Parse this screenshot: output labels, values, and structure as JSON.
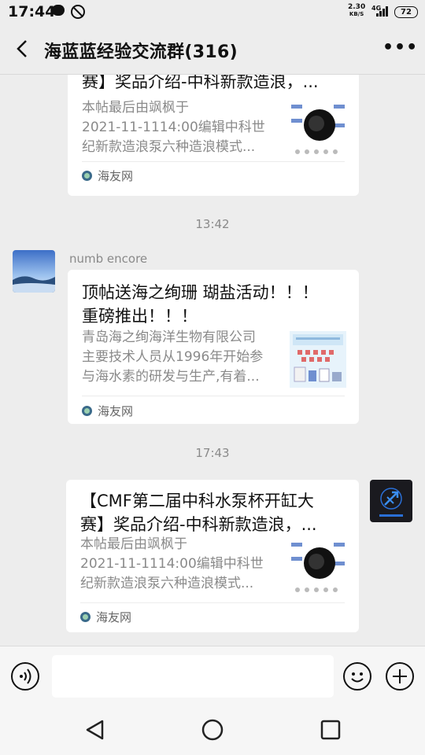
{
  "status_bar": {
    "time": "17:44",
    "net_speed_value": "2.30",
    "net_speed_unit": "KB/S",
    "signal_label": "4G",
    "battery": "72"
  },
  "header": {
    "title": "海蓝蓝经验交流群(316)",
    "more_label": "•••"
  },
  "messages": [
    {
      "type": "link-card",
      "title": "赛】奖品介绍-中科新款造浪，...",
      "desc": "本帖最后由飒枫于2021-11-1114:00编辑中科世纪新款造浪泵六种造浪模式...",
      "source": "海友网"
    },
    {
      "type": "timestamp",
      "text": "13:42"
    },
    {
      "type": "link-card",
      "sender": "numb encore",
      "title": "顶帖送海之绚珊 瑚盐活动！！！重磅推出！！！",
      "desc": "青岛海之绚海洋生物有限公司主要技术人员从1996年开始参与海水素的研发与生产,有着...",
      "source": "海友网"
    },
    {
      "type": "timestamp",
      "text": "17:43"
    },
    {
      "type": "link-card",
      "title": "【CMF第二届中科水泵杯开缸大赛】奖品介绍-中科新款造浪，...",
      "desc": "本帖最后由飒枫于2021-11-1114:00编辑中科世纪新款造浪泵六种造浪模式...",
      "source": "海友网"
    }
  ],
  "msg1": {
    "title_l1": "赛】奖品介绍-中科新款造浪，...",
    "desc_l1": "本帖最后由飒枫于",
    "desc_l2": "2021-11-1114:00编辑中科世",
    "desc_l3": "纪新款造浪泵六种造浪模式...",
    "source": "海友网"
  },
  "ts1": "13:42",
  "msg2": {
    "sender": "numb encore",
    "title_l1": "顶帖送海之绚珊 瑚盐活动！！！",
    "title_l2": "重磅推出！！！",
    "desc_l1": "青岛海之绚海洋生物有限公司",
    "desc_l2": "主要技术人员从1996年开始参",
    "desc_l3": "与海水素的研发与生产,有着...",
    "source": "海友网"
  },
  "ts2": "17:43",
  "msg3": {
    "title_l1": "【CMF第二届中科水泵杯开缸大",
    "title_l2": "赛】奖品介绍-中科新款造浪，...",
    "desc_l1": "本帖最后由飒枫于",
    "desc_l2": "2021-11-1114:00编辑中科世",
    "desc_l3": "纪新款造浪泵六种造浪模式...",
    "source": "海友网"
  },
  "input_bar": {
    "icons": [
      "voice-icon",
      "emoji-icon",
      "plus-icon"
    ]
  },
  "nav_bar": {
    "icons": [
      "back-triangle-icon",
      "home-circle-icon",
      "recents-square-icon"
    ]
  }
}
